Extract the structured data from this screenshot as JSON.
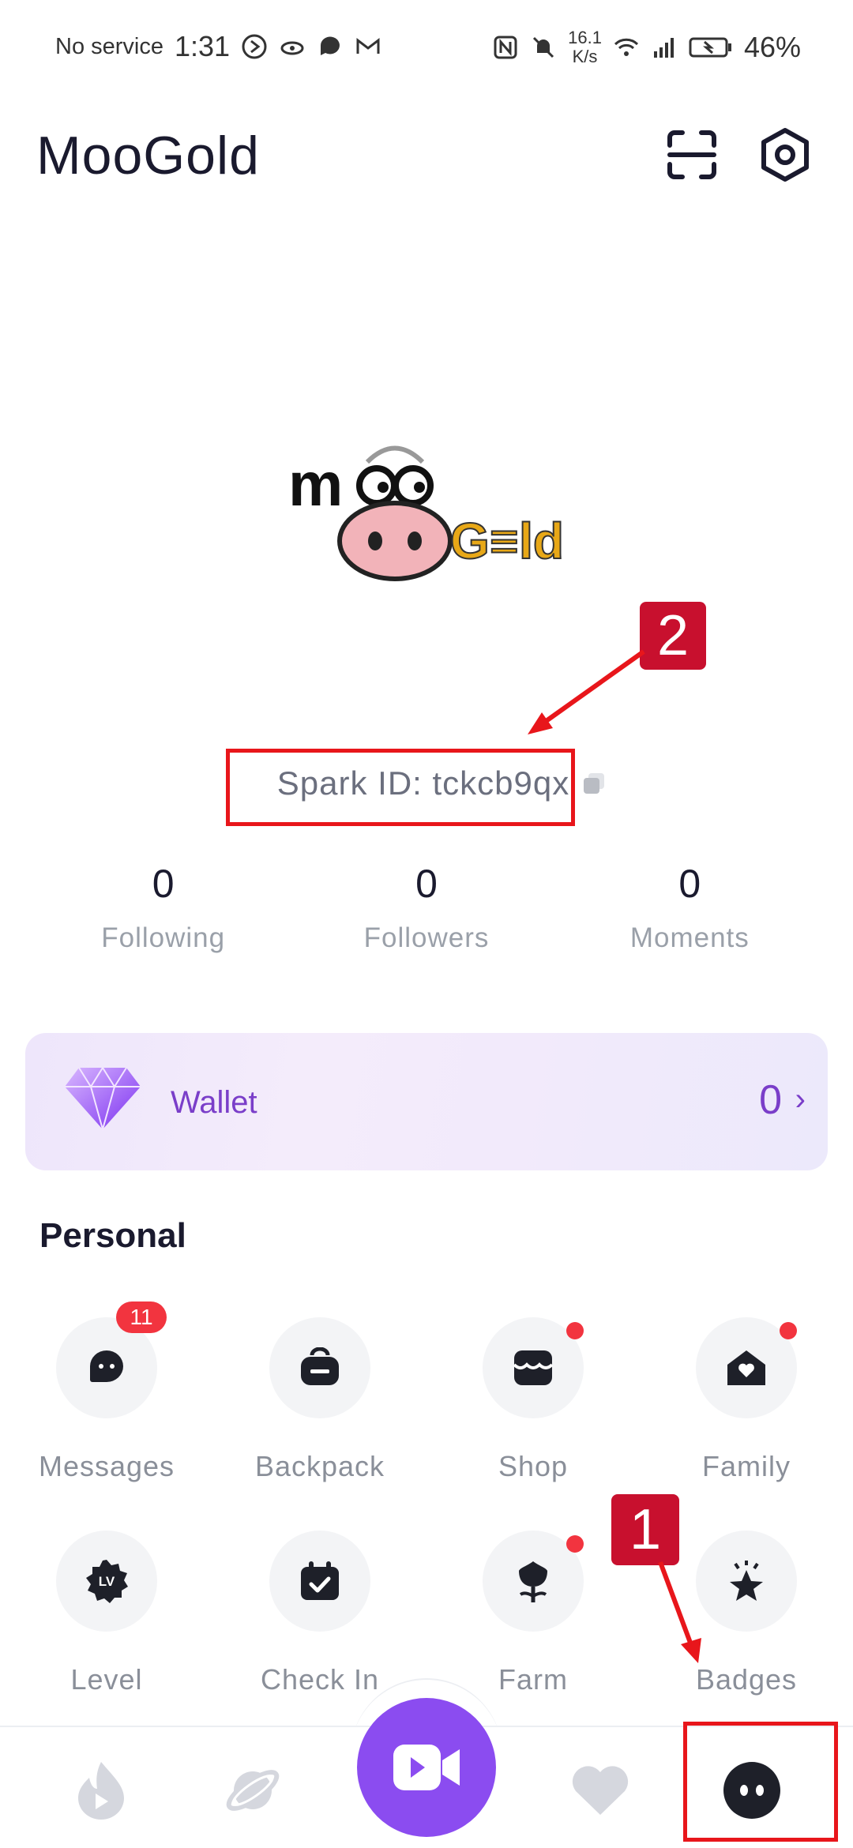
{
  "status_bar": {
    "service": "No service",
    "time": "1:31",
    "speed_value": "16.1",
    "speed_unit": "K/s",
    "battery": "46%"
  },
  "header": {
    "title": "MooGold",
    "scan_icon": "scan-icon",
    "settings_icon": "settings-gear-icon"
  },
  "profile": {
    "spark_id": "Spark ID: tckcb9qx"
  },
  "stats": [
    {
      "value": "0",
      "label": "Following"
    },
    {
      "value": "0",
      "label": "Followers"
    },
    {
      "value": "0",
      "label": "Moments"
    }
  ],
  "wallet": {
    "label": "Wallet",
    "value": "0"
  },
  "personal": {
    "title": "Personal",
    "row1": [
      {
        "label": "Messages",
        "icon": "message-bubble-icon",
        "badge": "11"
      },
      {
        "label": "Backpack",
        "icon": "backpack-icon"
      },
      {
        "label": "Shop",
        "icon": "shop-icon",
        "dot": true
      },
      {
        "label": "Family",
        "icon": "family-house-heart-icon",
        "dot": true
      }
    ],
    "row2": [
      {
        "label": "Level",
        "icon": "level-badge-icon"
      },
      {
        "label": "Check In",
        "icon": "calendar-check-icon"
      },
      {
        "label": "Farm",
        "icon": "tulip-icon",
        "dot": true
      },
      {
        "label": "Badges",
        "icon": "star-badge-icon"
      }
    ]
  },
  "bottom_nav": [
    "flame-icon",
    "planet-icon",
    "video-camera-icon",
    "heart-icon",
    "profile-face-icon"
  ],
  "annotations": {
    "one": "1",
    "two": "2"
  },
  "colors": {
    "accent": "#8b4cf0",
    "wallet_text": "#7a3ec9",
    "badge_red": "#f2343f",
    "annotation_red": "#e8161b"
  }
}
